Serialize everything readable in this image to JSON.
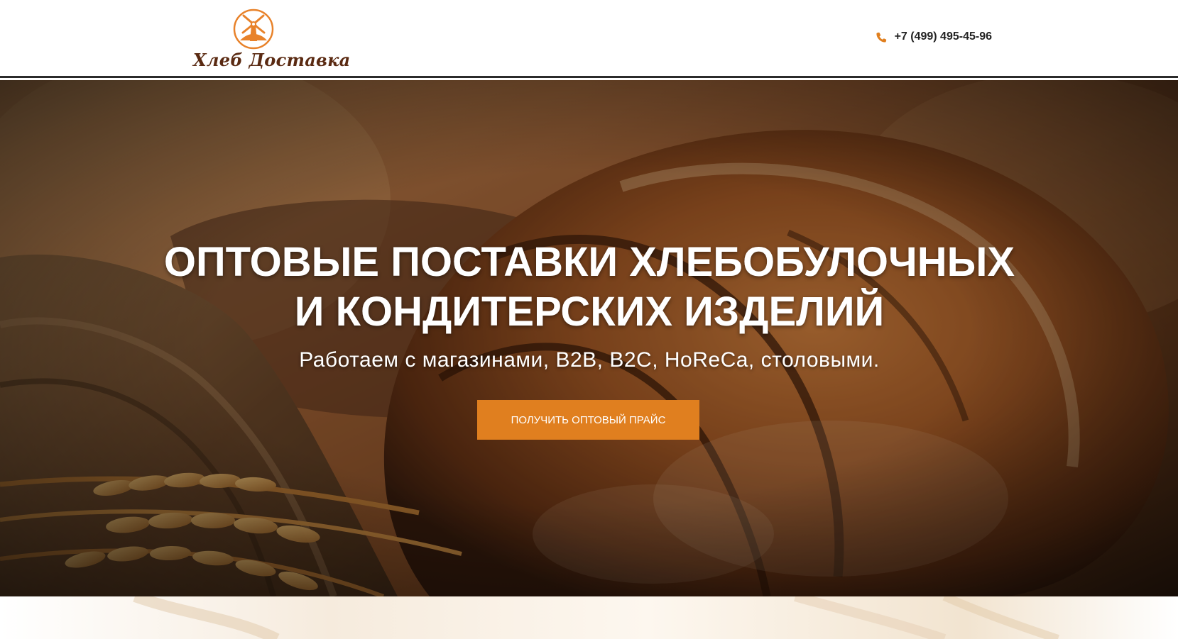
{
  "header": {
    "logo_text": "Хлеб Доставка",
    "logo_icon": "windmill-icon",
    "phone_icon": "phone-icon",
    "phone": "+7 (499) 495-45-96"
  },
  "hero": {
    "title_line1": "ОПТОВЫЕ ПОСТАВКИ ХЛЕБОБУЛОЧНЫХ",
    "title_line2": "И КОНДИТЕРСКИХ ИЗДЕЛИЙ",
    "subtitle": "Работаем с магазинами, B2B, B2C, HoReCa, столовыми.",
    "cta_label": "ПОЛУЧИТЬ ОПТОВЫЙ ПРАЙС"
  },
  "colors": {
    "accent": "#e07f1f",
    "logo_orange": "#e8822a",
    "logo_brown": "#5a2a12",
    "header_border": "#2b2b2b"
  }
}
